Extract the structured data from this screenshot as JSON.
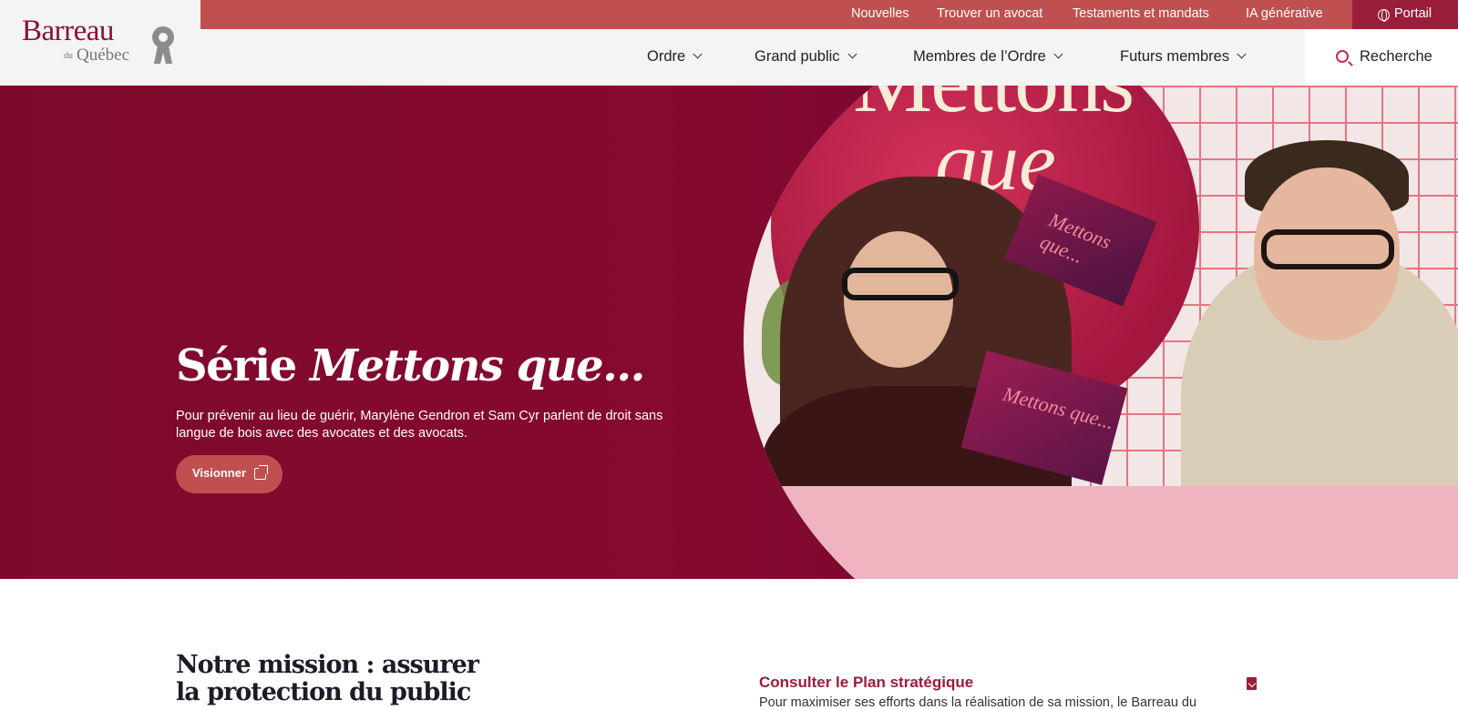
{
  "logo": {
    "barreau": "Barreau",
    "du": "du",
    "quebec": "Québec"
  },
  "topbar": {
    "links": [
      "Nouvelles",
      "Trouver un avocat",
      "Testaments et mandats",
      "IA générative"
    ],
    "portail": "Portail",
    "color": "#c0504f"
  },
  "nav": {
    "items": [
      "Ordre",
      "Grand public",
      "Membres de l’Ordre",
      "Futurs membres"
    ],
    "search": "Recherche"
  },
  "hero": {
    "title_prefix": "Série ",
    "title_em": "Mettons que...",
    "description": "Pour prévenir au lieu de guérir, Marylène Gendron et Sam Cyr parlent de droit sans langue de bois avec des avocates et des avocats.",
    "button": "Visionner",
    "photo_title_1": "Mettons",
    "photo_title_2": "que",
    "card_text": "Mettons que...",
    "background": "#7d0a2c"
  },
  "mission": {
    "title": "Notre mission : assurer la protection du public",
    "plan_link": "Consulter le Plan stratégique",
    "plan_desc": "Pour maximiser ses efforts dans la réalisation de sa mission, le Barreau du"
  }
}
